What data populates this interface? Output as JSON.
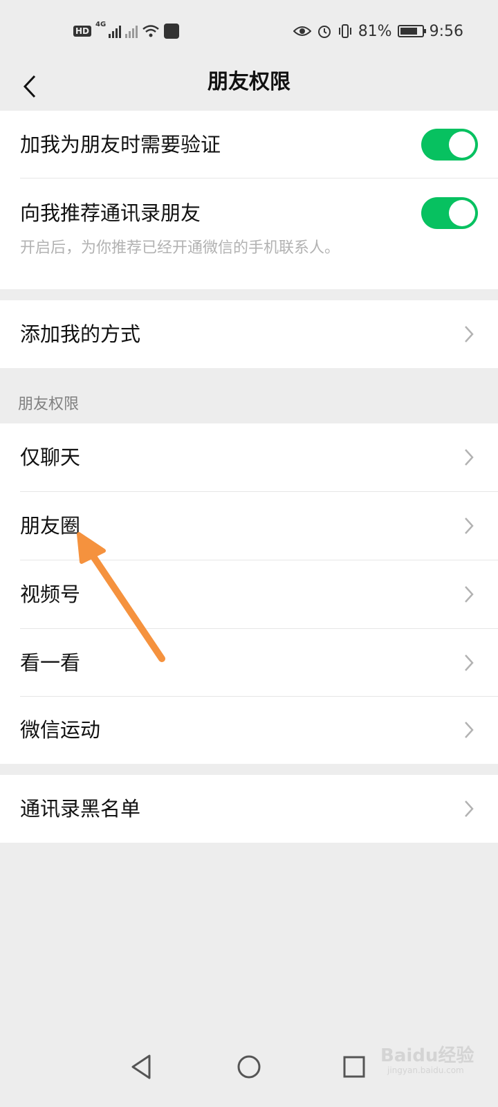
{
  "status_bar": {
    "hd_badge": "HD",
    "network_tag": "4G",
    "battery_text": "81%",
    "time": "9:56"
  },
  "nav": {
    "title": "朋友权限"
  },
  "verify_group": {
    "verify_label": "加我为朋友时需要验证",
    "verify_on": true,
    "recommend_label": "向我推荐通讯录朋友",
    "recommend_on": true,
    "recommend_desc": "开启后，为你推荐已经开通微信的手机联系人。"
  },
  "add_method": {
    "label": "添加我的方式"
  },
  "permissions_section": {
    "header": "朋友权限",
    "items": [
      {
        "label": "仅聊天"
      },
      {
        "label": "朋友圈"
      },
      {
        "label": "视频号"
      },
      {
        "label": "看一看"
      },
      {
        "label": "微信运动"
      }
    ]
  },
  "blacklist": {
    "label": "通讯录黑名单"
  },
  "colors": {
    "toggle_on": "#07c160",
    "annotation_arrow": "#f5923e",
    "background": "#ededed"
  },
  "watermark": {
    "text": "Baidu经验",
    "sub": "jingyan.baidu.com"
  }
}
